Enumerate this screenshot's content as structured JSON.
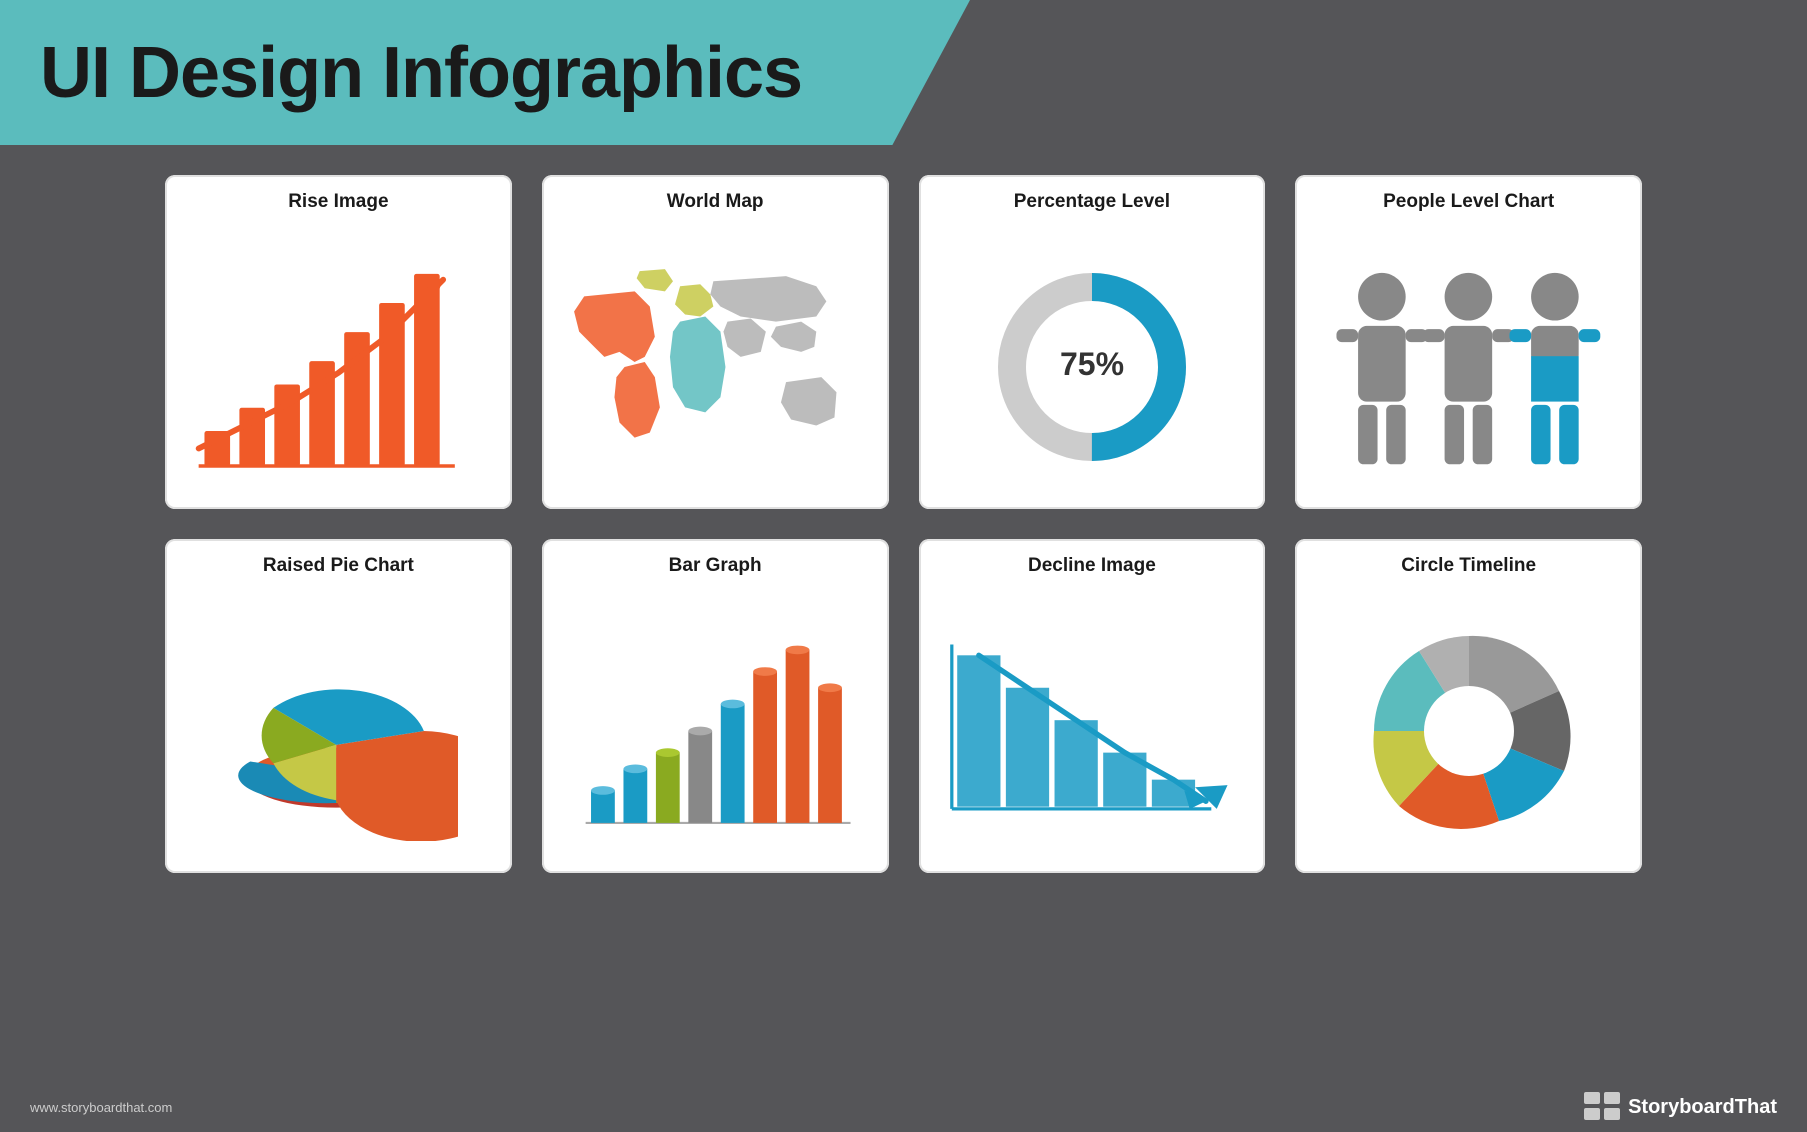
{
  "header": {
    "title": "UI Design Infographics"
  },
  "cards": [
    {
      "id": "rise-image",
      "label": "Rise Image"
    },
    {
      "id": "world-map",
      "label": "World Map"
    },
    {
      "id": "percentage-level",
      "label": "Percentage Level"
    },
    {
      "id": "people-level-chart",
      "label": "People Level Chart"
    },
    {
      "id": "raised-pie-chart",
      "label": "Raised Pie Chart"
    },
    {
      "id": "bar-graph",
      "label": "Bar Graph"
    },
    {
      "id": "decline-image",
      "label": "Decline Image"
    },
    {
      "id": "circle-timeline",
      "label": "Circle Timeline"
    }
  ],
  "percentage": {
    "value": "75%"
  },
  "footer": {
    "website": "www.storyboardthat.com",
    "brand_plain": "Storyboard",
    "brand_bold": "That"
  }
}
